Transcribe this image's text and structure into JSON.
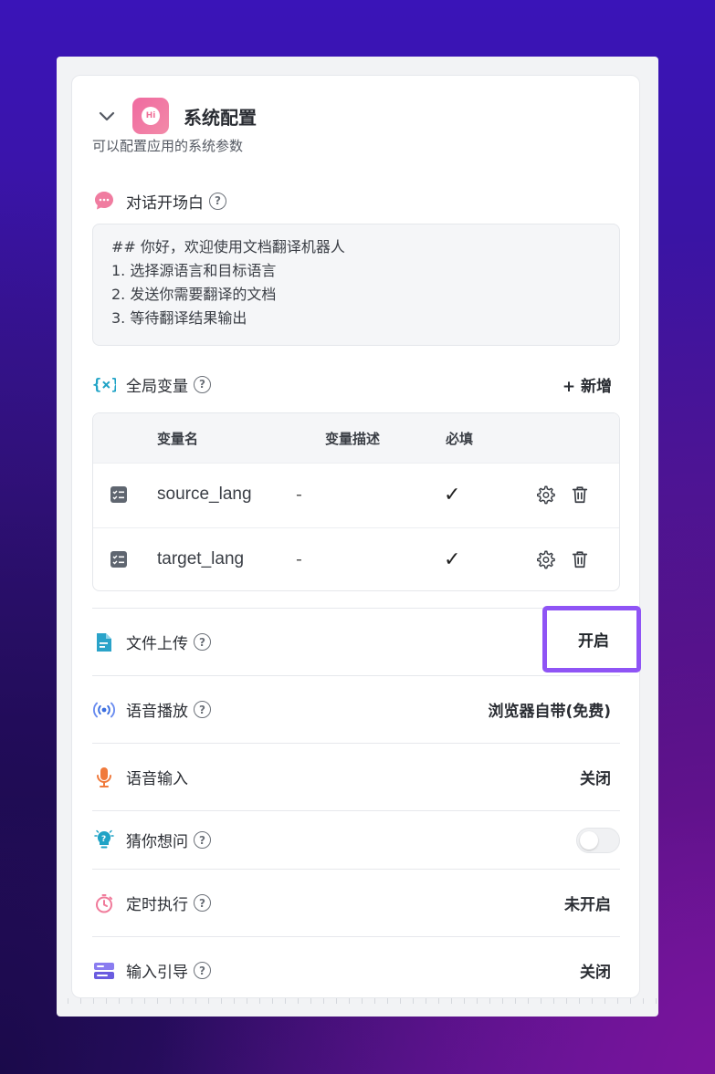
{
  "header": {
    "title": "系统配置",
    "subtitle": "可以配置应用的系统参数",
    "logo_text": "Hi"
  },
  "opener": {
    "label": "对话开场白",
    "lines": [
      "## 你好，欢迎使用文档翻译机器人",
      "1. 选择源语言和目标语言",
      "2. 发送你需要翻译的文档",
      "3. 等待翻译结果输出"
    ]
  },
  "variables": {
    "label": "全局变量",
    "add_label": "+ 新增",
    "columns": [
      "变量名",
      "变量描述",
      "必填"
    ],
    "rows": [
      {
        "name": "source_lang",
        "desc": "-",
        "required": "✓"
      },
      {
        "name": "target_lang",
        "desc": "-",
        "required": "✓"
      }
    ]
  },
  "settings": {
    "file_upload": {
      "label": "文件上传",
      "value": "开启"
    },
    "tts": {
      "label": "语音播放",
      "value": "浏览器自带(免费)"
    },
    "voice_input": {
      "label": "语音输入",
      "value": "关闭"
    },
    "guess": {
      "label": "猜你想问",
      "enabled": false
    },
    "schedule": {
      "label": "定时执行",
      "value": "未开启"
    },
    "input_guide": {
      "label": "输入引导",
      "value": "关闭"
    }
  },
  "help_glyph": "?",
  "colors": {
    "accent": "#8f54f5",
    "logo": "#f06aa0"
  }
}
